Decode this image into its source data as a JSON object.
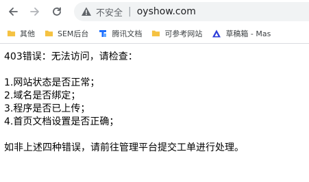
{
  "toolbar": {
    "back_icon": "arrow-left-icon",
    "forward_icon": "arrow-right-icon",
    "reload_icon": "reload-icon",
    "security_icon": "warning-triangle-icon",
    "security_label": "不安全",
    "separator": "|",
    "url": "oyshow.com"
  },
  "bookmarks": [
    {
      "label": "其他",
      "icon": "folder-icon"
    },
    {
      "label": "SEM后台",
      "icon": "folder-icon"
    },
    {
      "label": "腾讯文档",
      "icon": "tencent-docs-icon"
    },
    {
      "label": "可参考网站",
      "icon": "folder-icon"
    },
    {
      "label": "草稿箱 - Mas",
      "icon": "mastergo-icon"
    }
  ],
  "page": {
    "heading": "403错误：无法访问，请检查：",
    "items": [
      "1.网站状态是否正常；",
      "2.域名是否绑定；",
      "3.程序是否已上传；",
      "4.首页文档设置是否正确；"
    ],
    "footer": "如非上述四种错误，请前往管理平台提交工单进行处理。"
  },
  "colors": {
    "folder": "#f5c242",
    "tencent_blue": "#1e6fff",
    "mastergo": "#2a3bd9",
    "omnibox_bg": "#f1f3f4"
  }
}
